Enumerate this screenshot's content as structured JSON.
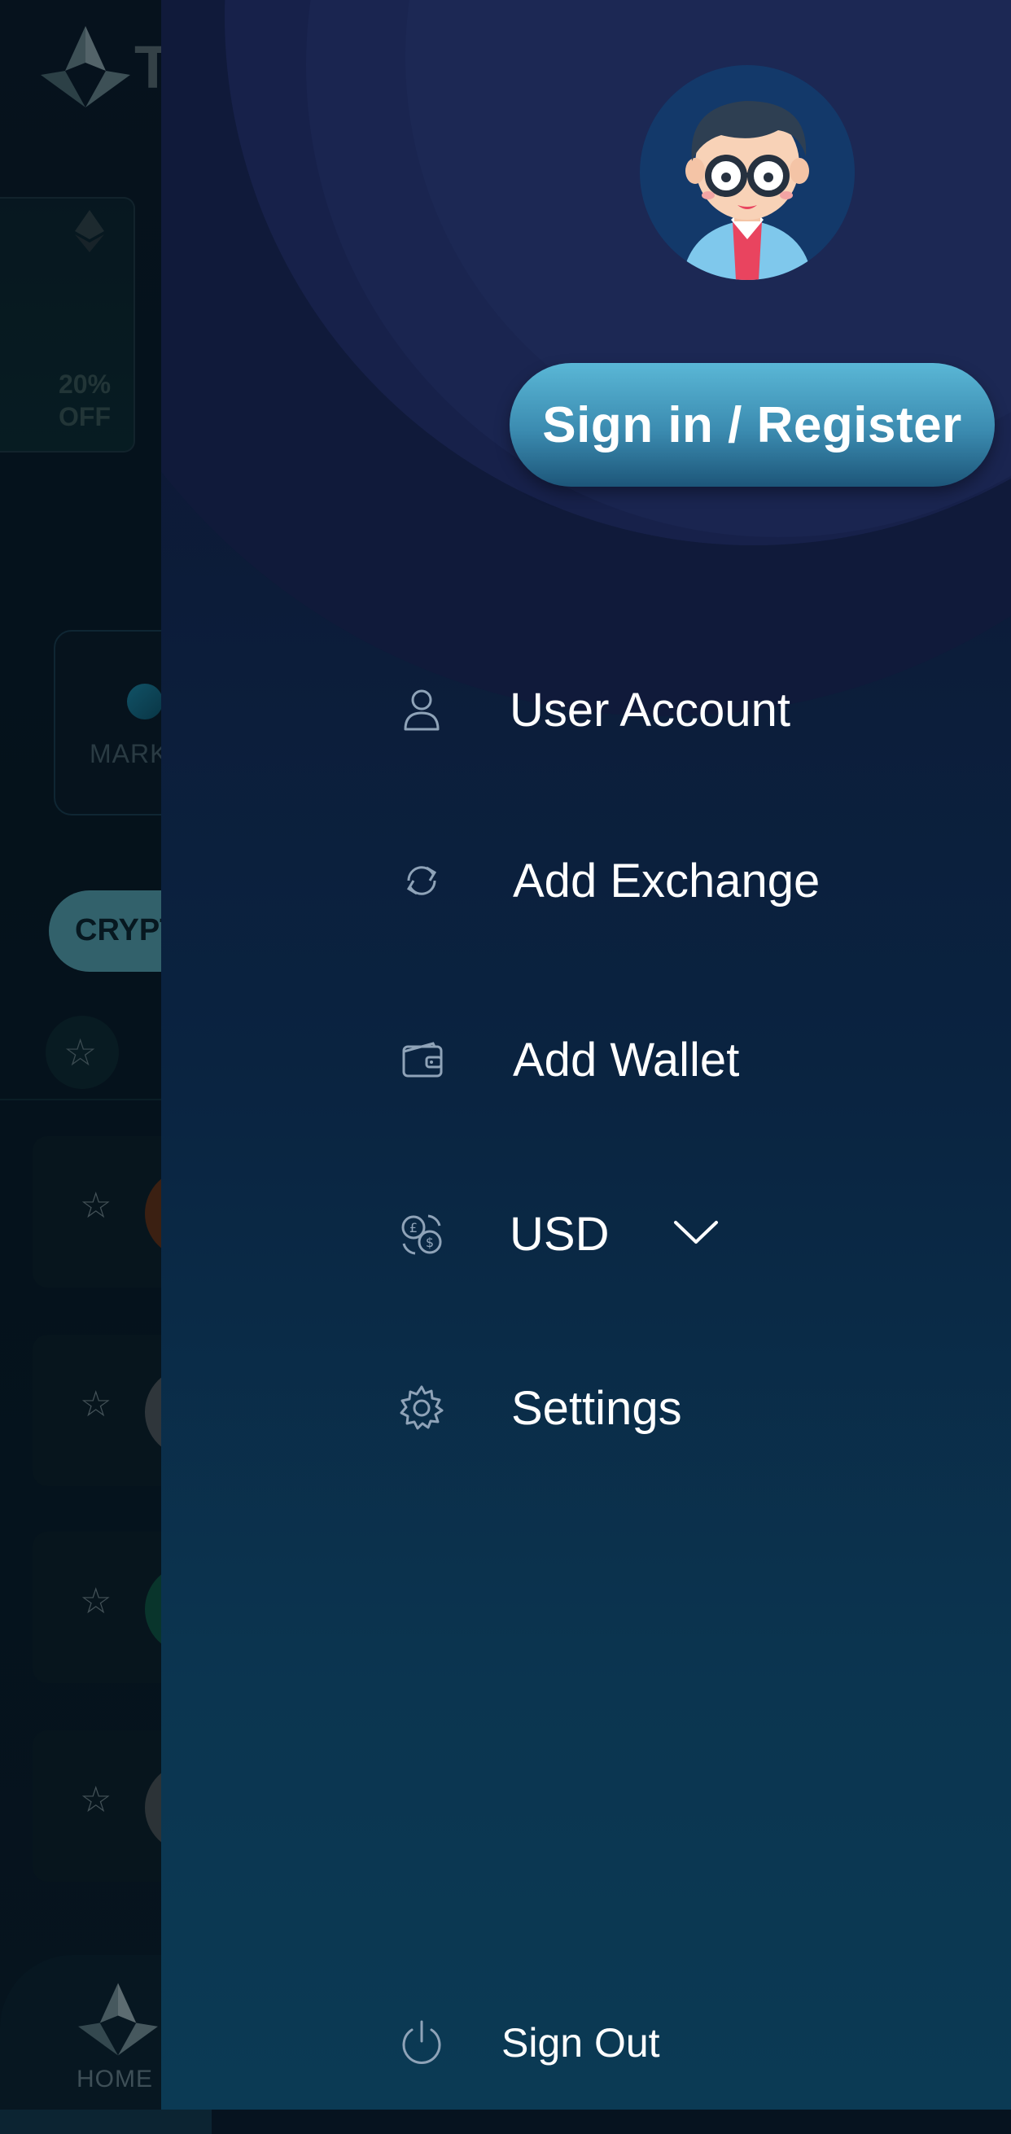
{
  "background": {
    "logo_letter": "T",
    "promo_text": "20%\nOFF",
    "markets_label": "MARK",
    "crypto_tab": "CRYPT",
    "nav_home": "HOME"
  },
  "drawer": {
    "signin_label": "Sign in / Register",
    "menu": [
      {
        "label": "User Account",
        "icon": "user-icon"
      },
      {
        "label": "Add Exchange",
        "icon": "exchange-icon"
      },
      {
        "label": "Add Wallet",
        "icon": "wallet-icon"
      },
      {
        "label": "USD",
        "icon": "currency-icon"
      },
      {
        "label": "Settings",
        "icon": "gear-icon"
      }
    ],
    "signout_label": "Sign Out"
  },
  "colors": {
    "accent": "#4aa6c8",
    "drawer_top": "#141c3d",
    "drawer_bottom": "#0b3a54",
    "icon": "#8fa3b8"
  }
}
